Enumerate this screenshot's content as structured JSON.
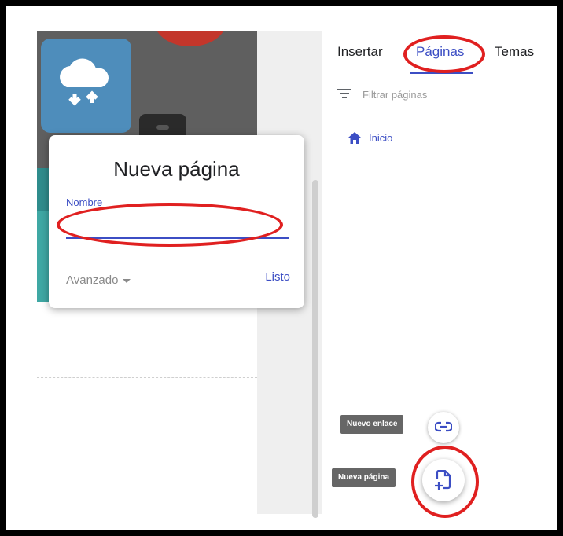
{
  "popup": {
    "title": "Nueva página",
    "field_label": "Nombre",
    "name_value": "",
    "advanced_label": "Avanzado",
    "done_label": "Listo"
  },
  "panel": {
    "tabs": [
      {
        "label": "Insertar",
        "active": false
      },
      {
        "label": "Páginas",
        "active": true
      },
      {
        "label": "Temas",
        "active": false
      }
    ],
    "filter_placeholder": "Filtrar páginas",
    "pages": [
      {
        "label": "Inicio",
        "icon": "home-icon"
      }
    ],
    "fab_link_tooltip": "Nuevo enlace",
    "fab_page_tooltip": "Nueva página"
  },
  "colors": {
    "accent": "#3c4ec4",
    "annotation_red": "#e02020",
    "tooltip_bg": "#666666"
  }
}
